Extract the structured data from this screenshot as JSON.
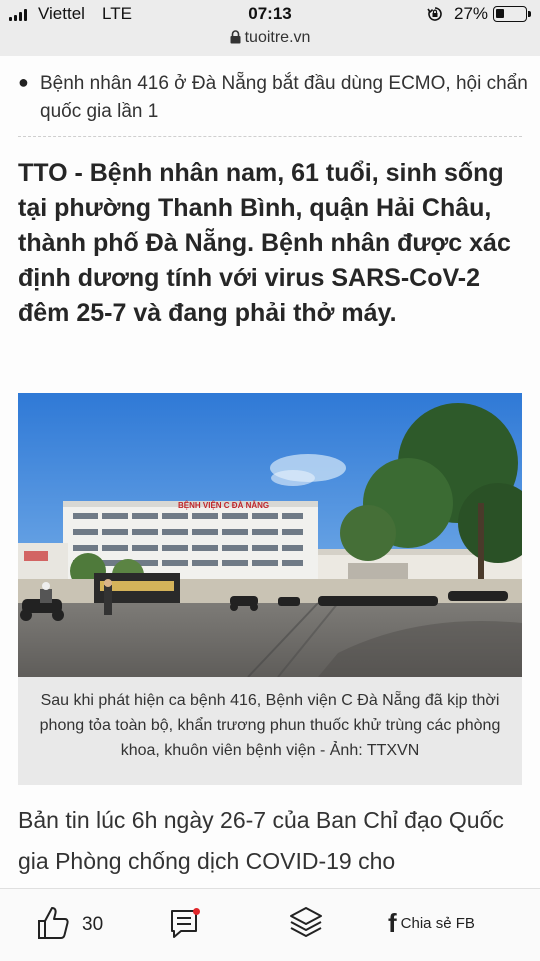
{
  "status_bar": {
    "carrier": "Viettel",
    "network": "LTE",
    "time": "07:13",
    "battery_percent": "27%",
    "url": "tuoitre.vn"
  },
  "article": {
    "related_headline": "Bệnh nhân 416 ở Đà Nẵng bắt đầu dùng ECMO, hội chẩn quốc gia lần 1",
    "lead": "TTO - Bệnh nhân nam, 61 tuổi, sinh sống tại phường Thanh Bình, quận Hải Châu, thành phố Đà Nẵng. Bệnh nhân được xác định dương tính với virus SARS-CoV-2 đêm 25-7 và đang phải thở máy.",
    "photo_sign": "BỆNH VIỆN C ĐÀ NẴNG",
    "caption": "Sau khi phát hiện ca bệnh 416, Bệnh viện C Đà Nẵng đã kịp thời phong tỏa toàn bộ, khẩn trương phun thuốc khử trùng các phòng khoa, khuôn viên bệnh viện - Ảnh: TTXVN",
    "body": "Bản tin lúc 6h ngày 26-7 của Ban Chỉ đạo Quốc gia Phòng chống dịch COVID-19 cho"
  },
  "toolbar": {
    "like_count": "30",
    "share_label": "Chia sẻ FB",
    "icons": [
      "thumbs-up-icon",
      "comment-icon",
      "layers-icon",
      "facebook-icon"
    ],
    "notification_color": "#e0272b"
  }
}
